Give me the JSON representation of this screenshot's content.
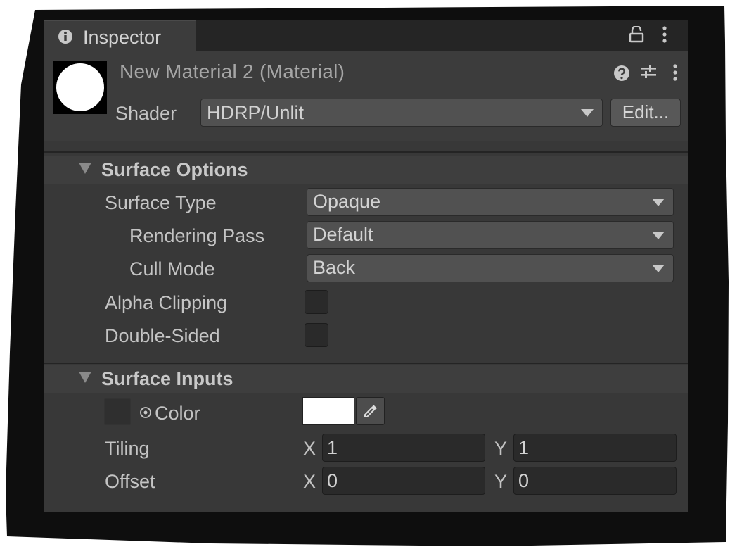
{
  "colors": {
    "panel_background": "#383838",
    "tab_bar_background": "#252525",
    "dropdown_background": "#515151",
    "field_background": "#2a2a2a",
    "color_swatch": "#ffffff",
    "preview_sphere": "#ffffff"
  },
  "tab": {
    "icon": "info-icon",
    "title": "Inspector",
    "lock_icon": "lock-icon",
    "menu_icon": "kebab-menu-icon"
  },
  "header": {
    "material_title": "New Material 2 (Material)",
    "shader_label": "Shader",
    "shader_value": "HDRP/Unlit",
    "edit_label": "Edit...",
    "icons": [
      "help-icon",
      "preset-icon",
      "kebab-menu-icon"
    ]
  },
  "surface_options": {
    "title": "Surface Options",
    "surface_type_label": "Surface Type",
    "surface_type_value": "Opaque",
    "rendering_pass_label": "Rendering Pass",
    "rendering_pass_value": "Default",
    "cull_mode_label": "Cull Mode",
    "cull_mode_value": "Back",
    "alpha_clipping_label": "Alpha Clipping",
    "alpha_clipping_checked": false,
    "double_sided_label": "Double-Sided",
    "double_sided_checked": false
  },
  "surface_inputs": {
    "title": "Surface Inputs",
    "color_label": "Color",
    "tiling_label": "Tiling",
    "tiling_x_label": "X",
    "tiling_x": "1",
    "tiling_y_label": "Y",
    "tiling_y": "1",
    "offset_label": "Offset",
    "offset_x_label": "X",
    "offset_x": "0",
    "offset_y_label": "Y",
    "offset_y": "0"
  }
}
